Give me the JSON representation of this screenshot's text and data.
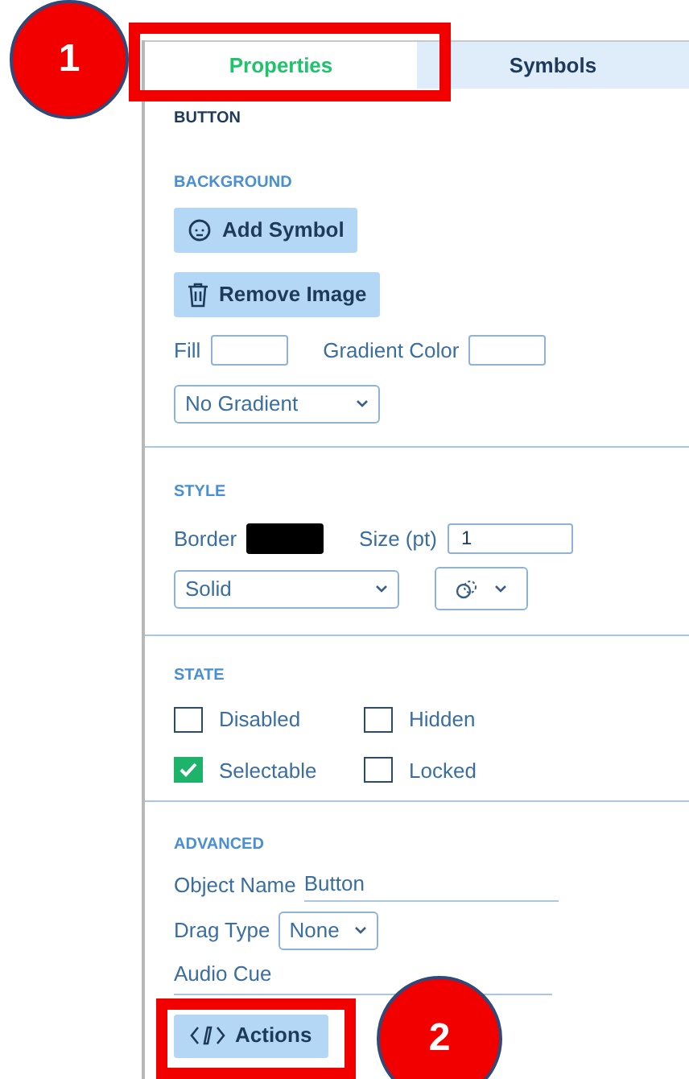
{
  "tabs": [
    {
      "label": "Properties",
      "selected": true
    },
    {
      "label": "Symbols",
      "selected": false
    }
  ],
  "object_type": "BUTTON",
  "background": {
    "heading": "BACKGROUND",
    "add_symbol": "Add Symbol",
    "remove_image": "Remove Image",
    "fill_label": "Fill",
    "gradient_label": "Gradient Color",
    "gradient_select": "No Gradient"
  },
  "style": {
    "heading": "STYLE",
    "border_label": "Border",
    "size_label": "Size (pt)",
    "size_value": "1",
    "line_select": "Solid"
  },
  "state": {
    "heading": "STATE",
    "options": [
      {
        "label": "Disabled",
        "checked": false
      },
      {
        "label": "Hidden",
        "checked": false
      },
      {
        "label": "Selectable",
        "checked": true
      },
      {
        "label": "Locked",
        "checked": false
      }
    ]
  },
  "advanced": {
    "heading": "ADVANCED",
    "object_name_label": "Object Name",
    "object_name_value": "Button",
    "drag_type_label": "Drag Type",
    "drag_type_select": "None",
    "audio_cue_label": "Audio Cue",
    "actions_button": "Actions"
  },
  "callouts": [
    {
      "number": "1"
    },
    {
      "number": "2"
    }
  ]
}
